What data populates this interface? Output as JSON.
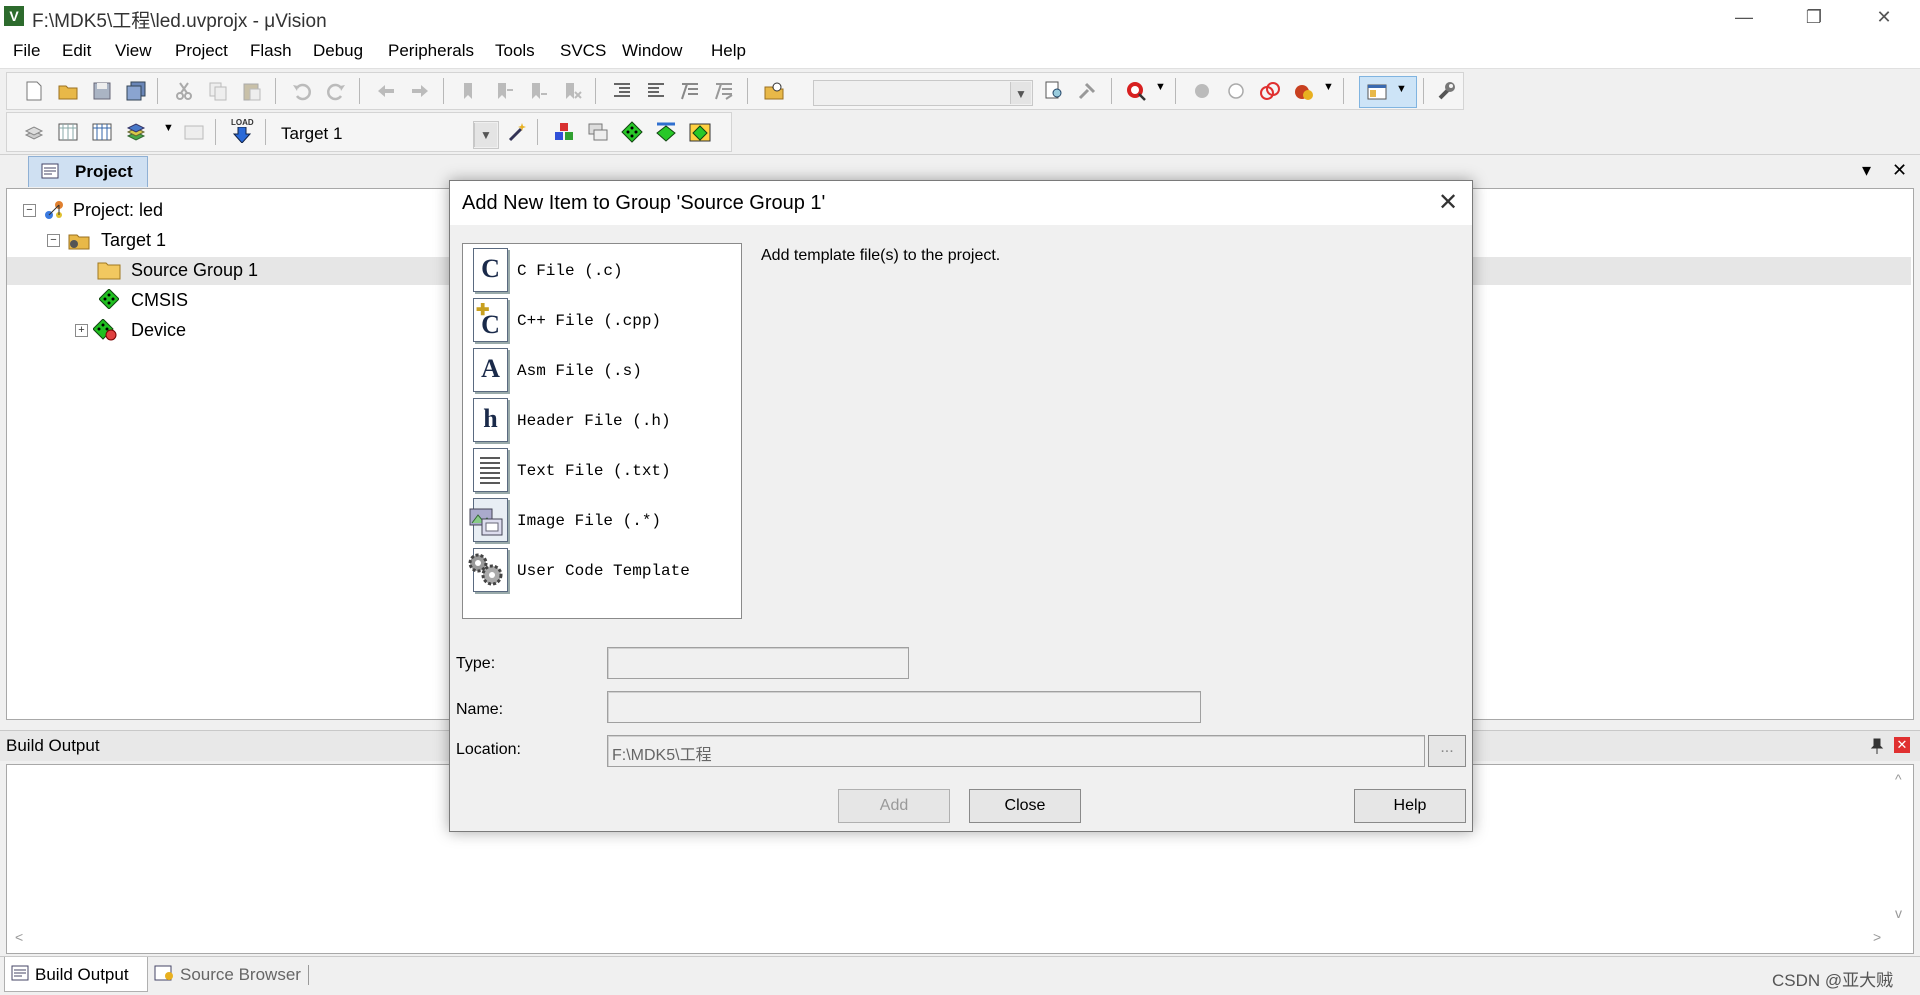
{
  "window": {
    "title": "F:\\MDK5\\工程\\led.uvprojx - μVision",
    "minimize": "—",
    "restore": "❐",
    "close": "✕"
  },
  "menu": [
    "File",
    "Edit",
    "View",
    "Project",
    "Flash",
    "Debug",
    "Peripherals",
    "Tools",
    "SVCS",
    "Window",
    "Help"
  ],
  "toolbar2": {
    "target": "Target 1",
    "load_text": "LOAD"
  },
  "project_panel": {
    "tab": "Project",
    "menu_arrow": "▾",
    "close": "✕",
    "tree": [
      {
        "label": "Project: led",
        "expander": "−"
      },
      {
        "label": "Target 1",
        "expander": "−"
      },
      {
        "label": "Source Group 1",
        "selected": true
      },
      {
        "label": "CMSIS"
      },
      {
        "label": "Device",
        "expander": "+"
      }
    ]
  },
  "build_output": {
    "title": "Build Output",
    "scroll_up": "^",
    "scroll_down": "v",
    "scroll_left": "<",
    "scroll_right": ">"
  },
  "bottom_tabs": [
    "Build Output",
    "Source Browser"
  ],
  "dialog": {
    "title": "Add New Item to Group 'Source Group 1'",
    "description": "Add template file(s) to the project.",
    "templates": [
      {
        "label": "C File (.c)",
        "glyph": "C"
      },
      {
        "label": "C++ File (.cpp)",
        "glyph": "C"
      },
      {
        "label": "Asm File (.s)",
        "glyph": "A"
      },
      {
        "label": "Header File (.h)",
        "glyph": "h"
      },
      {
        "label": "Text File (.txt)",
        "glyph": ""
      },
      {
        "label": "Image File (.*)",
        "glyph": ""
      },
      {
        "label": "User Code Template",
        "glyph": ""
      }
    ],
    "type_label": "Type:",
    "name_label": "Name:",
    "location_label": "Location:",
    "location_value": "F:\\MDK5\\工程",
    "browse": "...",
    "add": "Add",
    "close": "Close",
    "help": "Help"
  },
  "watermark": "CSDN @亚大贼"
}
